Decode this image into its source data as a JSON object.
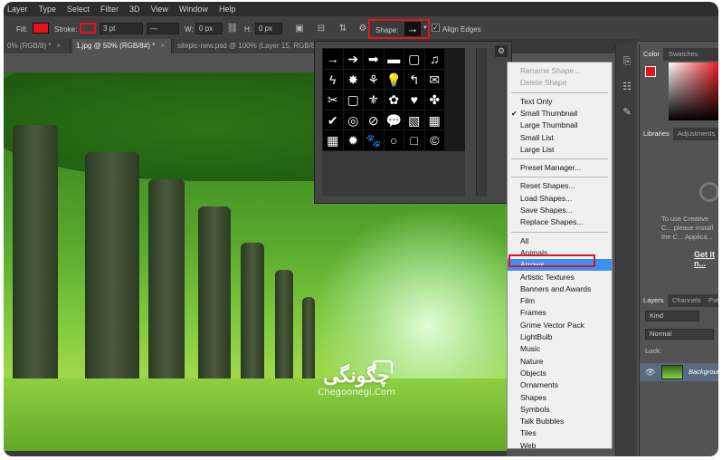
{
  "menubar": [
    "Layer",
    "Type",
    "Select",
    "Filter",
    "3D",
    "View",
    "Window",
    "Help"
  ],
  "options": {
    "fill_label": "Fill:",
    "stroke_label": "Stroke:",
    "stroke_width": "3 pt",
    "w_label": "W:",
    "w_value": "0 px",
    "h_label": "H:",
    "h_value": "0 px",
    "shape_label": "Shape:",
    "align_edges": "Align Edges",
    "fill_color": "#e8131a"
  },
  "tabs": [
    {
      "label": "0% (RGB/8) *",
      "close": "×"
    },
    {
      "label": "1.jpg @ 50% (RGB/8#) *",
      "close": "×"
    },
    {
      "label": "sitepic-new.psd @ 100% (Layer 15, RGB/8",
      "close": "×"
    }
  ],
  "shape_grid": [
    "→",
    "➔",
    "➡",
    "▬",
    "▢",
    "♫",
    "ϟ",
    "✸",
    "⚘",
    "💡",
    "↰",
    "✉",
    "✂",
    "▢",
    "⚜",
    "✿",
    "♥",
    "✤",
    "✔",
    "◎",
    "⊘",
    "💬",
    "▧",
    "▦",
    "▦",
    "✹",
    "🐾",
    "○",
    "□",
    "©",
    "®",
    "™"
  ],
  "flyout": {
    "items": [
      {
        "label": "Rename Shape...",
        "state": "disabled"
      },
      {
        "label": "Delete Shape",
        "state": "disabled"
      },
      {
        "sep": true
      },
      {
        "label": "Text Only"
      },
      {
        "label": "Small Thumbnail",
        "checked": true
      },
      {
        "label": "Large Thumbnail"
      },
      {
        "label": "Small List"
      },
      {
        "label": "Large List"
      },
      {
        "sep": true
      },
      {
        "label": "Preset Manager..."
      },
      {
        "sep": true
      },
      {
        "label": "Reset Shapes..."
      },
      {
        "label": "Load Shapes..."
      },
      {
        "label": "Save Shapes..."
      },
      {
        "label": "Replace Shapes..."
      },
      {
        "sep": true
      },
      {
        "label": "All"
      },
      {
        "label": "Animals"
      },
      {
        "label": "Arrows",
        "state": "selected"
      },
      {
        "label": "Artistic Textures"
      },
      {
        "label": "Banners and Awards"
      },
      {
        "label": "Film"
      },
      {
        "label": "Frames"
      },
      {
        "label": "Grime Vector Pack"
      },
      {
        "label": "LightBulb"
      },
      {
        "label": "Music"
      },
      {
        "label": "Nature"
      },
      {
        "label": "Objects"
      },
      {
        "label": "Ornaments"
      },
      {
        "label": "Shapes"
      },
      {
        "label": "Symbols"
      },
      {
        "label": "Talk Bubbles"
      },
      {
        "label": "Tiles"
      },
      {
        "label": "Web"
      }
    ]
  },
  "panels": {
    "color_tab": "Color",
    "swatches_tab": "Swatches",
    "libraries_tab": "Libraries",
    "adjustments_tab": "Adjustments",
    "lib_msg": "To use Creative C... please install the C... Applica...",
    "lib_link": "Get it n...",
    "layers_tab": "Layers",
    "channels_tab": "Channels",
    "paths_tab": "Path",
    "kind": "Kind",
    "blend": "Normal",
    "lock": "Lock:",
    "layer_name": "Backgroun"
  },
  "watermark": {
    "fa": "چگونگی",
    "lat": "Chegoonegi.Com"
  },
  "icons": {
    "shape_arrow": "→",
    "gear": "⚙",
    "eye": "👁"
  }
}
